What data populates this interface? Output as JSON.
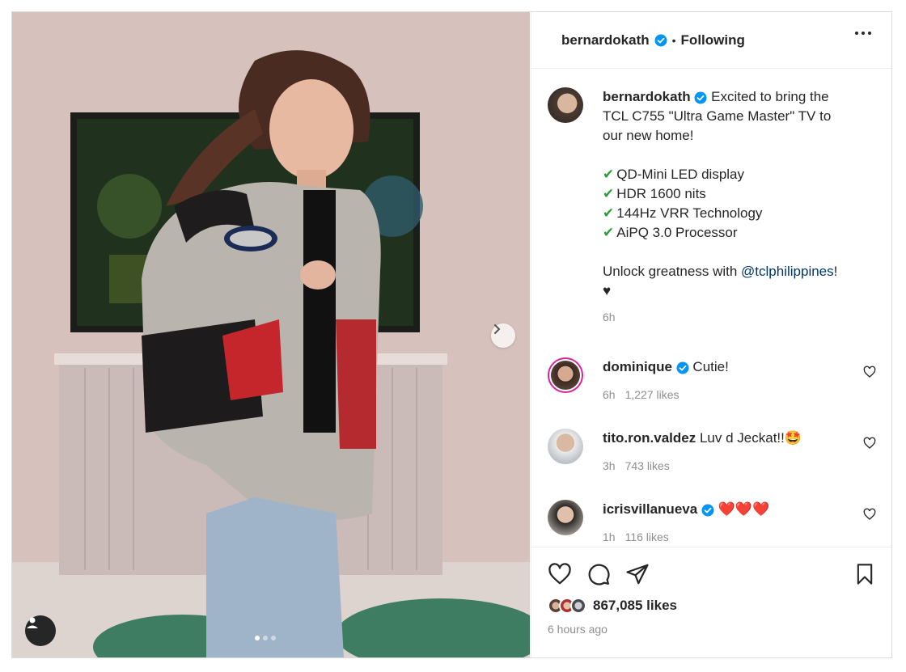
{
  "post": {
    "username": "bernardokath",
    "follow_status": "Following",
    "separator": "•",
    "caption_lines": [
      "Excited to bring the",
      "TCL C755 \"Ultra Game Master\" TV to",
      "our new home!"
    ],
    "features": [
      "QD-Mini LED display",
      "HDR 1600 nits",
      "144Hz VRR Technology",
      "AiPQ 3.0 Processor"
    ],
    "cta_prefix": "Unlock greatness with ",
    "cta_mention": "@tclphilippines",
    "cta_suffix": "!",
    "cta_heart": "♥",
    "caption_time": "6h",
    "likes": "867,085 likes",
    "posted_ago": "6 hours ago",
    "photo_count": 3,
    "photo_index": 1
  },
  "comments": [
    {
      "username": "dominique",
      "verified": true,
      "text": "Cutie!",
      "time": "6h",
      "likes": "1,227 likes"
    },
    {
      "username": "tito.ron.valdez",
      "verified": false,
      "text": "Luv d Jeckat!!🤩",
      "time": "3h",
      "likes": "743 likes"
    },
    {
      "username": "icrisvillanueva",
      "verified": true,
      "text": "❤️❤️❤️",
      "time": "1h",
      "likes": "116 likes"
    }
  ],
  "icons": {
    "verified": "verified-badge-icon",
    "more": "more-options-icon",
    "next": "chevron-right-icon",
    "tag": "user-tag-icon",
    "like": "heart-icon",
    "comment": "comment-icon",
    "share": "share-icon",
    "save": "bookmark-icon"
  },
  "colors": {
    "verified_blue": "#0095f6",
    "check_green": "#2e9e3a",
    "mention_blue": "#00376b",
    "secondary_text": "#8e8e8e"
  }
}
